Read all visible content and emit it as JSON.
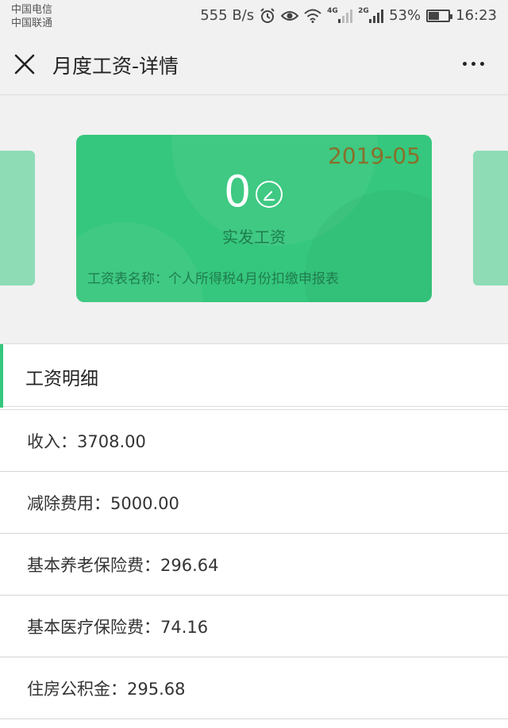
{
  "status_bar": {
    "carrier_1": "中国电信",
    "carrier_2": "中国联通",
    "net_speed": "555 B/s",
    "net1_tag": "4G",
    "net2_tag": "2G",
    "battery": "53%",
    "battery_level": 0.53,
    "time": "16:23",
    "icons": [
      "alarm-icon",
      "eye-icon",
      "wifi-icon",
      "signal-icon",
      "battery-icon"
    ]
  },
  "nav": {
    "title": "月度工资-详情",
    "close_icon": "close-icon",
    "more_icon": "more-icon"
  },
  "card": {
    "date": "2019-05",
    "amount": "0",
    "label": "实发工资",
    "sheet_name": "工资表名称：个人所得税4月份扣缴申报表",
    "color": "#35c77d",
    "date_color": "#8a6f2a"
  },
  "details": {
    "title": "工资明细",
    "rows": [
      "收入：3708.00",
      "减除费用：5000.00",
      "基本养老保险费：296.64",
      "基本医疗保险费：74.16",
      "住房公积金：295.68"
    ]
  }
}
